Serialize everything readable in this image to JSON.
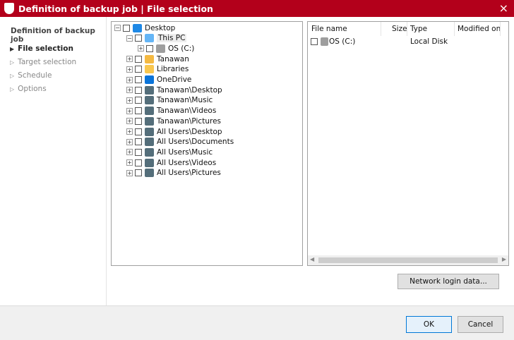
{
  "window": {
    "title": "Definition of backup job | File selection",
    "close_icon": "×",
    "logo": "G"
  },
  "sidebar": {
    "heading": "Definition of backup job",
    "steps": [
      {
        "label": "File selection",
        "active": true
      },
      {
        "label": "Target selection"
      },
      {
        "label": "Schedule"
      },
      {
        "label": "Options"
      }
    ]
  },
  "tree": {
    "items": [
      {
        "label": "Desktop",
        "exp": "−",
        "icon": "#1e88e5"
      },
      {
        "label": "This PC",
        "exp": "−",
        "icon": "#64b5f6"
      },
      {
        "label": "OS (C:)",
        "exp": "+",
        "icon": "#9e9e9e"
      },
      {
        "label": "Tanawan",
        "exp": "+",
        "icon": "#f4b942"
      },
      {
        "label": "Libraries",
        "exp": "+",
        "icon": "#f9c74f"
      },
      {
        "label": "OneDrive",
        "exp": "+",
        "icon": "#0a74d9"
      },
      {
        "label": "Tanawan\\Desktop",
        "exp": "+",
        "icon": "#546e7a"
      },
      {
        "label": "Tanawan\\Music",
        "exp": "+",
        "icon": "#546e7a"
      },
      {
        "label": "Tanawan\\Videos",
        "exp": "+",
        "icon": "#546e7a"
      },
      {
        "label": "Tanawan\\Pictures",
        "exp": "+",
        "icon": "#546e7a"
      },
      {
        "label": "All Users\\Desktop",
        "exp": "+",
        "icon": "#546e7a"
      },
      {
        "label": "All Users\\Documents",
        "exp": "+",
        "icon": "#546e7a"
      },
      {
        "label": "All Users\\Music",
        "exp": "+",
        "icon": "#546e7a"
      },
      {
        "label": "All Users\\Videos",
        "exp": "+",
        "icon": "#546e7a"
      },
      {
        "label": "All Users\\Pictures",
        "exp": "+",
        "icon": "#546e7a"
      }
    ]
  },
  "list": {
    "columns": {
      "name": "File name",
      "size": "Size",
      "type": "Type",
      "modified": "Modified on"
    },
    "rows": [
      {
        "name": "OS (C:)",
        "size": "",
        "type": "Local Disk",
        "modified": ""
      }
    ]
  },
  "buttons": {
    "network": "Network login data...",
    "ok": "OK",
    "cancel": "Cancel"
  }
}
